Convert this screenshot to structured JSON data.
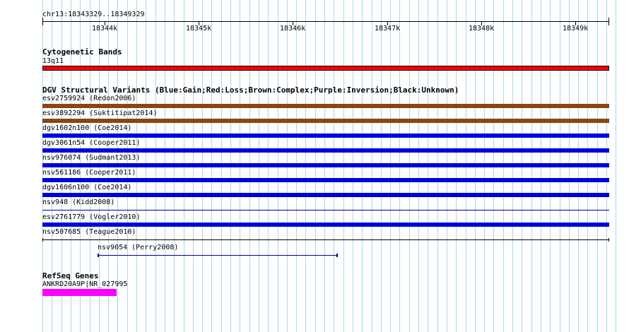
{
  "ruler": {
    "region_label": "chr13:18343329..18349329",
    "tick_labels": [
      "18344k",
      "18345k",
      "18346k",
      "18347k",
      "18348k",
      "18349k"
    ]
  },
  "cytobands": {
    "title": "Cytogenetic Bands",
    "band_label": "13q11",
    "band_color": "#ff0000"
  },
  "dgv": {
    "title": "DGV Structural Variants (Blue:Gain;Red:Loss;Brown:Complex;Purple:Inversion;Black:Unknown)",
    "colors": {
      "gain": "#0000dd",
      "complex": "#8b4513",
      "unknown": "#000000",
      "thin_gain": "#00008b"
    },
    "variants": [
      {
        "label": "esv2759924 (Redon2006)",
        "type": "complex"
      },
      {
        "label": "esv3892294 (Suktitipat2014)",
        "type": "complex"
      },
      {
        "label": "dgv1602n100 (Coe2014)",
        "type": "gain"
      },
      {
        "label": "dgv3061n54 (Cooper2011)",
        "type": "gain"
      },
      {
        "label": "nsv976074 (Sudmant2013)",
        "type": "gain"
      },
      {
        "label": "nsv561186 (Cooper2011)",
        "type": "gain"
      },
      {
        "label": "dgv1606n100 (Coe2014)",
        "type": "gain"
      },
      {
        "label": "nsv948 (Kidd2008)",
        "type": "thin_gain"
      },
      {
        "label": "esv2761779 (Vogler2010)",
        "type": "gain"
      },
      {
        "label": "nsv507685 (Teague2010)",
        "type": "unknown"
      },
      {
        "label": "nsv9054 (Perry2008)",
        "type": "thin_gain"
      }
    ]
  },
  "refseq": {
    "title": "RefSeq Genes",
    "gene_label": "ANKRD20A9P|NR_027995",
    "gene_color": "#ff00ff"
  },
  "gridline_color": "#a6d8ee"
}
